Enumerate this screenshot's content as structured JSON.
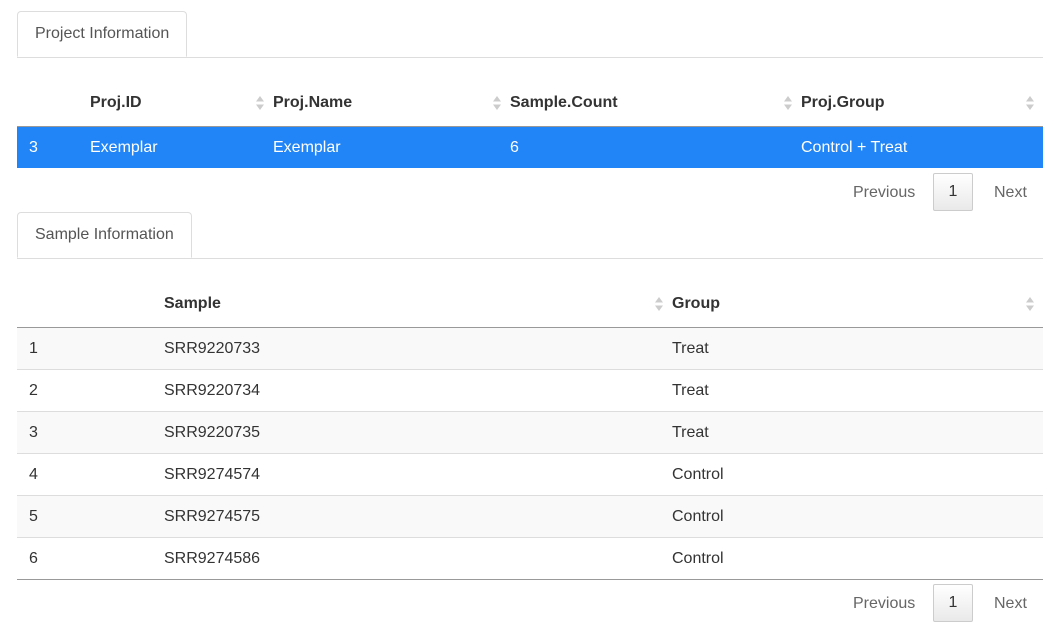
{
  "project": {
    "tab_label": "Project Information",
    "columns": [
      "",
      "Proj.ID",
      "Proj.Name",
      "Sample.Count",
      "Proj.Group"
    ],
    "rows": [
      [
        "3",
        "Exemplar",
        "Exemplar",
        "6",
        "Control + Treat"
      ]
    ],
    "selected_row": 0,
    "pager": {
      "previous": "Previous",
      "page": "1",
      "next": "Next"
    }
  },
  "samples": {
    "tab_label": "Sample Information",
    "columns": [
      "",
      "Sample",
      "Group"
    ],
    "rows": [
      [
        "1",
        "SRR9220733",
        "Treat"
      ],
      [
        "2",
        "SRR9220734",
        "Treat"
      ],
      [
        "3",
        "SRR9220735",
        "Treat"
      ],
      [
        "4",
        "SRR9274574",
        "Control"
      ],
      [
        "5",
        "SRR9274575",
        "Control"
      ],
      [
        "6",
        "SRR9274586",
        "Control"
      ]
    ],
    "pager": {
      "previous": "Previous",
      "page": "1",
      "next": "Next"
    }
  },
  "colors": {
    "selected_row": "#2185f7",
    "stripe_row": "#f9f9f9",
    "sort_icon": "#cccccc"
  }
}
